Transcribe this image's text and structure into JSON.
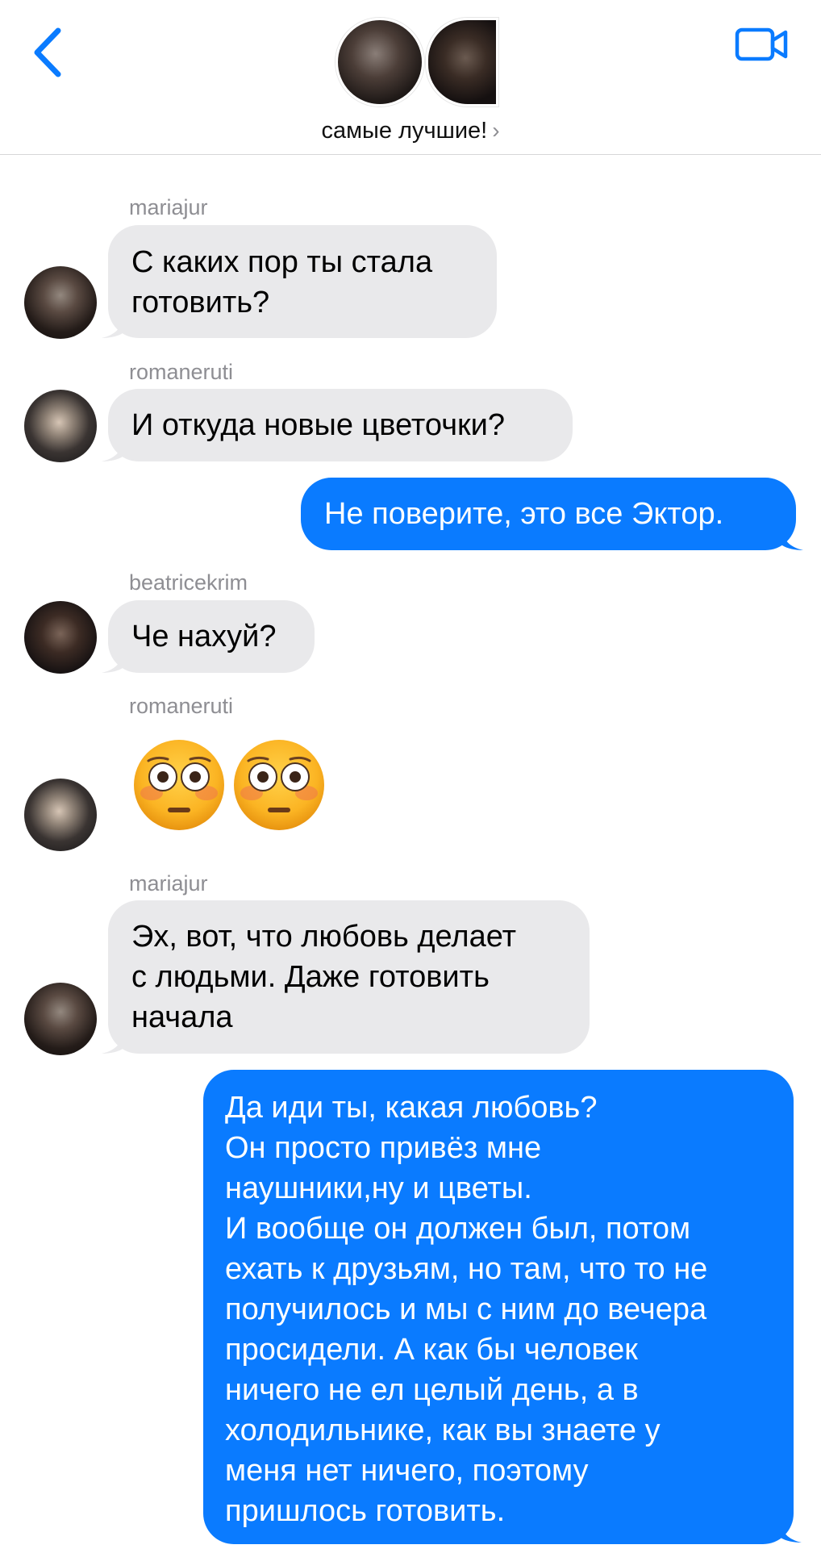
{
  "header": {
    "back_icon": "chevron-left-icon",
    "video_icon": "video-camera-icon",
    "group_title": "самые лучшие!",
    "title_chevron": "›",
    "accent_color": "#0a7bff"
  },
  "messages": [
    {
      "sender": "mariajur",
      "text": "С каких пор ты стала\nготовить?",
      "direction": "incoming"
    },
    {
      "sender": "romaneruti",
      "text": "И откуда новые цветочки?",
      "direction": "incoming"
    },
    {
      "text": "Не поверите, это все Эктор.",
      "direction": "outgoing"
    },
    {
      "sender": "beatricekrim",
      "text": "Че нахуй?",
      "direction": "incoming"
    },
    {
      "sender": "romaneruti",
      "emoji": "flushed-face-icon x2",
      "direction": "incoming"
    },
    {
      "sender": "mariajur",
      "text": "Эх, вот, что любовь делает\nс людьми. Даже готовить\nначала",
      "direction": "incoming"
    },
    {
      "text": "Да иди ты, какая любовь?\nОн просто привёз мне\nнаушники,ну и цветы.\nИ вообще он должен был, потом\nехать к друзьям, но там, что то не\nполучилось и мы с ним до вечера\nпросидели. А как бы человек\nничего не ел целый день, а в\nхолодильнике, как вы знаете у\nменя нет ничего, поэтому\nпришлось готовить.",
      "direction": "outgoing"
    }
  ],
  "colors": {
    "incoming_bubble": "#e9e9eb",
    "outgoing_bubble": "#0a7bff",
    "sender_label": "#8e8e93"
  }
}
